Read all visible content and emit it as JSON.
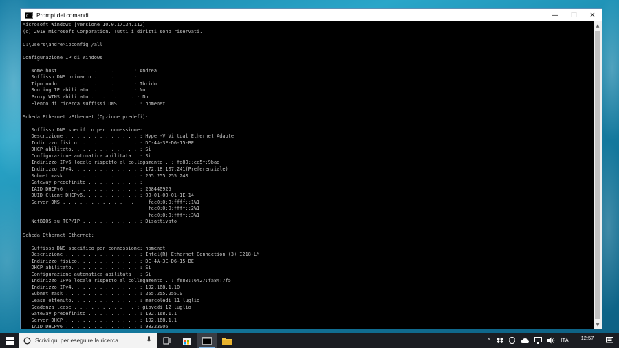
{
  "window": {
    "title": "Prompt dei comandi",
    "app_icon_text": "C:\\",
    "controls": {
      "minimize": "—",
      "maximize": "☐",
      "close": "✕"
    }
  },
  "console": {
    "lines": [
      "Microsoft Windows [Versione 10.0.17134.112]",
      "(c) 2018 Microsoft Corporation. Tutti i diritti sono riservati.",
      "",
      "C:\\Users\\andre>ipconfig /all",
      "",
      "Configurazione IP di Windows",
      "",
      "   Nome host . . . . . . . . . . . . . : Andrea",
      "   Suffisso DNS primario . . . . . . . :",
      "   Tipo nodo . . . . . . . . . . . . . : Ibrido",
      "   Routing IP abilitato. . . . . . . . : No",
      "   Proxy WINS abilitato . . . . . . . . : No",
      "   Elenco di ricerca suffissi DNS. . . . : homenet",
      "",
      "Scheda Ethernet vEthernet (Opzione predefi):",
      "",
      "   Suffisso DNS specifico per connessione:",
      "   Descrizione . . . . . . . . . . . . . : Hyper-V Virtual Ethernet Adapter",
      "   Indirizzo fisico. . . . . . . . . . . : DC-4A-3E-D6-15-BE",
      "   DHCP abilitato. . . . . . . . . . . . : Sì",
      "   Configurazione automatica abilitata   : Sì",
      "   Indirizzo IPv6 locale rispetto al collegamento . : fe80::ec5f:9bad",
      "   Indirizzo IPv4. . . . . . . . . . . . : 172.18.107.241(Preferenziale)",
      "   Subnet mask . . . . . . . . . . . . . : 255.255.255.240",
      "   Gateway predefinito . . . . . . . . . :",
      "   IAID DHCPv6 . . . . . . . . . . . . . : 268440925",
      "   DUID Client DHCPv6. . . . . . . . . . : 00-01-00-01-1E-14",
      "   Server DNS . . . . . . . . . . . . .     fec0:0:0:ffff::1%1",
      "                                            fec0:0:0:ffff::2%1",
      "                                            fec0:0:0:ffff::3%1",
      "   NetBIOS su TCP/IP . . . . . . . . . . : Disattivato",
      "",
      "Scheda Ethernet Ethernet:",
      "",
      "   Suffisso DNS specifico per connessione: homenet",
      "   Descrizione . . . . . . . . . . . . . : Intel(R) Ethernet Connection (3) I218-LM",
      "   Indirizzo fisico. . . . . . . . . . . : DC-4A-3E-D6-15-BE",
      "   DHCP abilitato. . . . . . . . . . . . : Sì",
      "   Configurazione automatica abilitata   : Sì",
      "   Indirizzo IPv6 locale rispetto al collegamento . : fe80::6427:fa84:7f5",
      "   Indirizzo IPv4. . . . . . . . . . . . : 192.168.1.10",
      "   Subnet mask . . . . . . . . . . . . . : 255.255.255.0",
      "   Lease ottenuto. . . . . . . . . . . . : mercoledì 11 luglio",
      "   Scadenza lease . . . . . . . . . . . : giovedì 12 luglio",
      "   Gateway predefinito . . . . . . . . . : 192.168.1.1",
      "   Server DHCP . . . . . . . . . . . . . : 192.168.1.1",
      "   IAID DHCPv6 . . . . . . . . . . . . . : 98323006"
    ]
  },
  "taskbar": {
    "search_placeholder": "Scrivi qui per eseguire la ricerca",
    "language": "ITA",
    "time": "12:57"
  }
}
